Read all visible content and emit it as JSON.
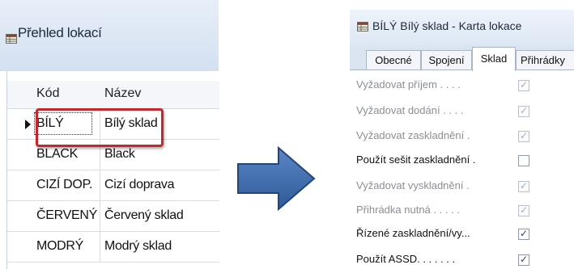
{
  "left_window": {
    "title": "Přehled lokací",
    "columns": [
      "Kód",
      "Název"
    ],
    "rows": [
      {
        "code": "BÍLÝ",
        "name": "Bílý sklad",
        "selected": true
      },
      {
        "code": "BLACK",
        "name": "Black",
        "selected": false
      },
      {
        "code": "CIZÍ DOP.",
        "name": "Cizí doprava",
        "selected": false
      },
      {
        "code": "ČERVENÝ",
        "name": "Červený sklad",
        "selected": false
      },
      {
        "code": "MODRÝ",
        "name": "Modrý sklad",
        "selected": false
      }
    ]
  },
  "right_window": {
    "title": "BÍLÝ Bílý sklad - Karta lokace",
    "tabs": [
      {
        "label": "Obecné",
        "active": false
      },
      {
        "label": "Spojení",
        "active": false
      },
      {
        "label": "Sklad",
        "active": true
      },
      {
        "label": "Přihrádky",
        "active": false
      }
    ],
    "fields": [
      {
        "label": "Vyžadovat příjem . . . .",
        "checked": true,
        "enabled": false
      },
      {
        "label": "Vyžadovat dodání . . . .",
        "checked": true,
        "enabled": false
      },
      {
        "label": "Vyžadovat zaskladnění .",
        "checked": true,
        "enabled": false
      },
      {
        "label": "Použít sešit zaskladnění .",
        "checked": false,
        "enabled": true
      },
      {
        "label": "Vyžadovat vyskladnění .",
        "checked": true,
        "enabled": false
      },
      {
        "label": "Přihrádka nutná . . . . .",
        "checked": true,
        "enabled": false
      },
      {
        "label": "Řízené zaskladnění/vy...",
        "checked": true,
        "enabled": true
      },
      {
        "label": "Použít ASSD. . . . . . .",
        "checked": true,
        "enabled": true
      }
    ]
  },
  "icons": {
    "window_icon": "table-icon",
    "arrow": "right-arrow-icon",
    "row_indicator": "current-row-triangle-icon",
    "check": "check-icon"
  },
  "colors": {
    "highlight": "#c2282c",
    "arrow_fill": "#3e6aab",
    "arrow_stroke": "#23457a",
    "check_mark": "#2b3a8c"
  }
}
